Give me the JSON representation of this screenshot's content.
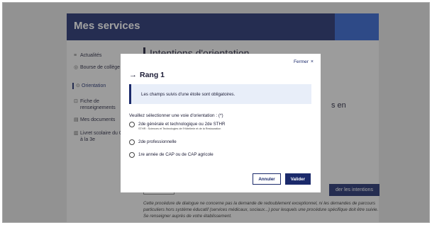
{
  "page": {
    "header_title": "Mes services",
    "main_title": "Intentions d'orientation",
    "side_text": "s en",
    "submit_label": "der les intentions",
    "notice": "Cette procédure de dialogue ne concerne pas la demande de redoublement exceptionnel, ni les demandes de parcours particuliers hors système éducatif (services médicaux, sociaux...) pour lesquels une procédure spécifique doit être suivie. Se renseigner auprès de votre établissement."
  },
  "sidebar": {
    "items": [
      {
        "label": "Actualités",
        "icon": "≡"
      },
      {
        "label": "Bourse de collège",
        "icon": "◎"
      },
      {
        "label": "Orientation",
        "icon": "⊙"
      },
      {
        "label": "Fiche de renseignements",
        "icon": "⊡"
      },
      {
        "label": "Mes documents",
        "icon": "▤"
      },
      {
        "label": "Livret scolaire du CP à la 3e",
        "icon": "▥"
      }
    ]
  },
  "modal": {
    "close_label": "Fermer",
    "close_icon": "×",
    "title": "Rang 1",
    "title_icon": "→",
    "info": "Les champs suivis d'une étoile sont obligatoires.",
    "question": "Veuillez sélectionner une voie d'orientation : (*)",
    "options": [
      {
        "label": "2de générale et technologique ou 2de STHR",
        "sub": "STHR : Sciences et Technologies de l'Hôtellerie et de la Restauration"
      },
      {
        "label": "2de professionnelle",
        "sub": ""
      },
      {
        "label": "1re année de CAP ou de CAP agricole",
        "sub": ""
      }
    ],
    "cancel_label": "Annuler",
    "ok_label": "Valider"
  }
}
